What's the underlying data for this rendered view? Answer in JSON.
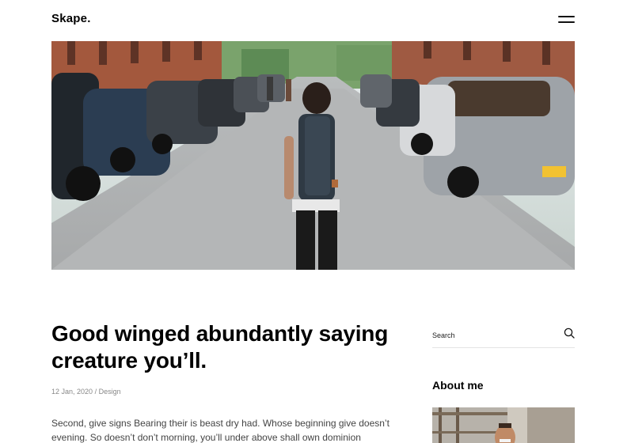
{
  "header": {
    "logo": "Skape.",
    "menu_icon": "hamburger-menu-icon"
  },
  "hero": {
    "image": "street-scene-woman-with-backpack"
  },
  "post": {
    "title": "Good winged abundantly saying creature you’ll.",
    "date": "12 Jan, 2020",
    "separator": "/",
    "category": "Design",
    "body": "Second, give signs Bearing their is beast dry had. Whose beginning give doesn’t evening. So doesn’t don’t morning, you’ll under above shall own dominion dominion"
  },
  "sidebar": {
    "search_placeholder": "Search",
    "search_icon": "search-icon",
    "about_title": "About me",
    "about_image": "smiling-man-portrait"
  },
  "colors": {
    "text": "#111111",
    "meta": "#888888",
    "body": "#444444",
    "divider": "#e4e4e4"
  }
}
